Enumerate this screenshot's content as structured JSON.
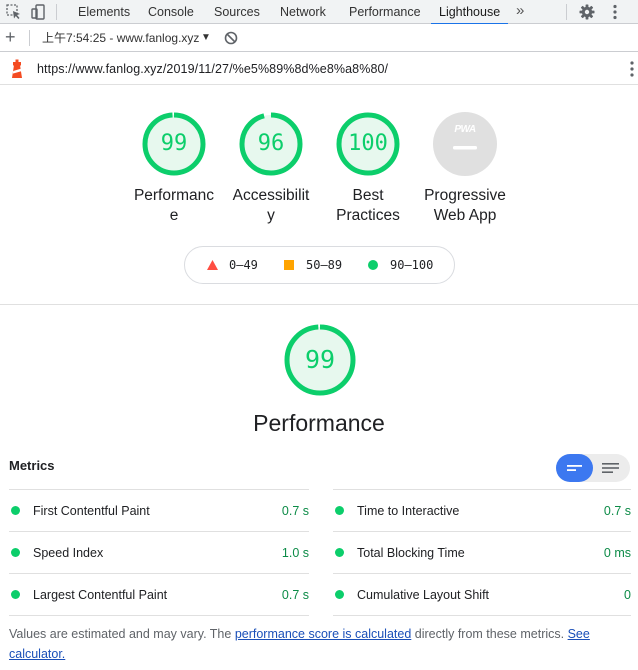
{
  "devtools": {
    "tabs": [
      "Elements",
      "Console",
      "Sources",
      "Network",
      "Performance",
      "Lighthouse"
    ],
    "active_tab": "Lighthouse",
    "more_label": "»"
  },
  "toolbar": {
    "add_label": "+",
    "report_label": "上午7:54:25 - www.fanlog.xyz",
    "caret": "▼"
  },
  "url": "https://www.fanlog.xyz/2019/11/27/%e5%89%8d%e8%a8%80/",
  "colors": {
    "pass": "#0cce6b",
    "pass_bg": "#e7f8ee",
    "average": "#ffa400",
    "fail": "#ff4e42",
    "toggle_active": "#3c78f0"
  },
  "categories": [
    {
      "score": "99",
      "score_fraction": 0.99,
      "label_line1": "Performanc",
      "label_line2": "e"
    },
    {
      "score": "96",
      "score_fraction": 0.96,
      "label_line1": "Accessibilit",
      "label_line2": "y"
    },
    {
      "score": "100",
      "score_fraction": 1.0,
      "label_line1": "Best",
      "label_line2": "Practices"
    },
    {
      "score": "",
      "badge": "PWA",
      "label_line1": "Progressive",
      "label_line2": "Web App"
    }
  ],
  "legend": [
    {
      "shape": "triangle",
      "label": "0–49"
    },
    {
      "shape": "square",
      "label": "50–89"
    },
    {
      "shape": "circle",
      "label": "90–100"
    }
  ],
  "performance": {
    "score": "99",
    "score_fraction": 0.99,
    "title": "Performance"
  },
  "metrics": {
    "title": "Metrics",
    "left": [
      {
        "name": "First Contentful Paint",
        "value": "0.7 s"
      },
      {
        "name": "Speed Index",
        "value": "1.0 s"
      },
      {
        "name": "Largest Contentful Paint",
        "value": "0.7 s"
      }
    ],
    "right": [
      {
        "name": "Time to Interactive",
        "value": "0.7 s"
      },
      {
        "name": "Total Blocking Time",
        "value": "0 ms"
      },
      {
        "name": "Cumulative Layout Shift",
        "value": "0"
      }
    ]
  },
  "footnote": {
    "text1": "Values are estimated and may vary. The ",
    "link1": "performance score is calculated",
    "text2": " directly from these metrics. ",
    "link2": "See calculator."
  }
}
